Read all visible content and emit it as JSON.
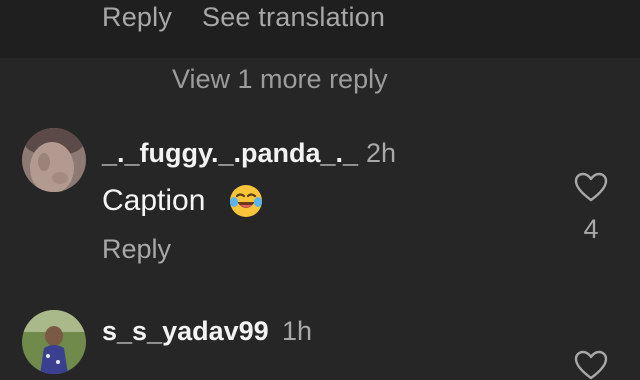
{
  "top_actions": {
    "reply_label": "Reply",
    "see_translation_label": "See translation"
  },
  "view_more": {
    "label": "View 1 more reply"
  },
  "comments": [
    {
      "username": "_._fuggy._.panda_._",
      "time": "2h",
      "text": "Caption",
      "emoji_icon": "face-with-tears-of-joy-icon",
      "reply_label": "Reply",
      "likes": "4"
    },
    {
      "username": "s_s_yadav99",
      "time": "1h"
    }
  ],
  "colors": {
    "background": "#262626",
    "top_band": "#1f1f1f",
    "primary_text": "#f5f5f5",
    "secondary_text": "#a8a8a8"
  }
}
